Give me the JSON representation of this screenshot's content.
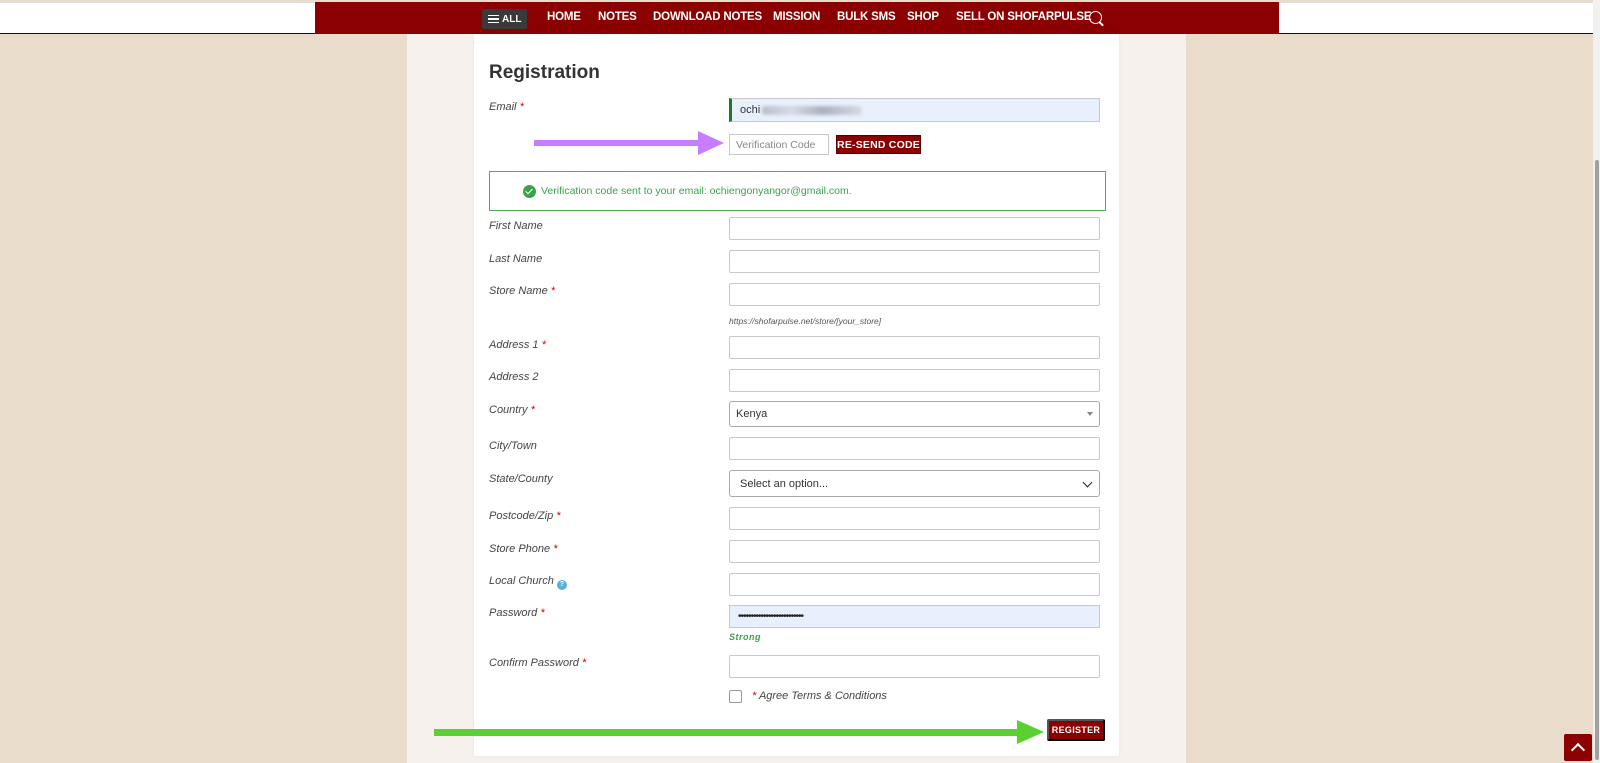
{
  "nav": {
    "all_label": "ALL",
    "items": [
      "HOME",
      "NOTES",
      "DOWNLOAD NOTES",
      "MISSION",
      "BULK SMS",
      "SHOP",
      "SELL ON SHOFARPULSE"
    ]
  },
  "form": {
    "title": "Registration",
    "email_label": "Email",
    "email_value": "ochi",
    "verification_placeholder": "Verification Code",
    "resend_label": "RE-SEND CODE",
    "notice_text": "Verification code sent to your email: ochiengonyangor@gmail.com.",
    "first_name_label": "First Name",
    "last_name_label": "Last Name",
    "store_name_label": "Store Name",
    "store_url_hint": "https://shofarpulse.net/store/[your_store]",
    "address1_label": "Address 1",
    "address2_label": "Address 2",
    "country_label": "Country",
    "country_value": "Kenya",
    "city_label": "City/Town",
    "state_label": "State/County",
    "state_value": "Select an option...",
    "postcode_label": "Postcode/Zip",
    "phone_label": "Store Phone",
    "church_label": "Local Church",
    "church_info": "?",
    "password_label": "Password",
    "password_dots": "••••••••••••••••••••••••••",
    "strength": "Strong",
    "confirm_label": "Confirm Password",
    "required_mark": "*",
    "agree_label": "Agree  Terms & Conditions",
    "register_label": "REGISTER"
  },
  "colors": {
    "brand": "#8b0000",
    "success": "#3aa34a",
    "background": "#eadccb",
    "arrow_purple": "#c77dff",
    "arrow_green": "#5ad130"
  }
}
